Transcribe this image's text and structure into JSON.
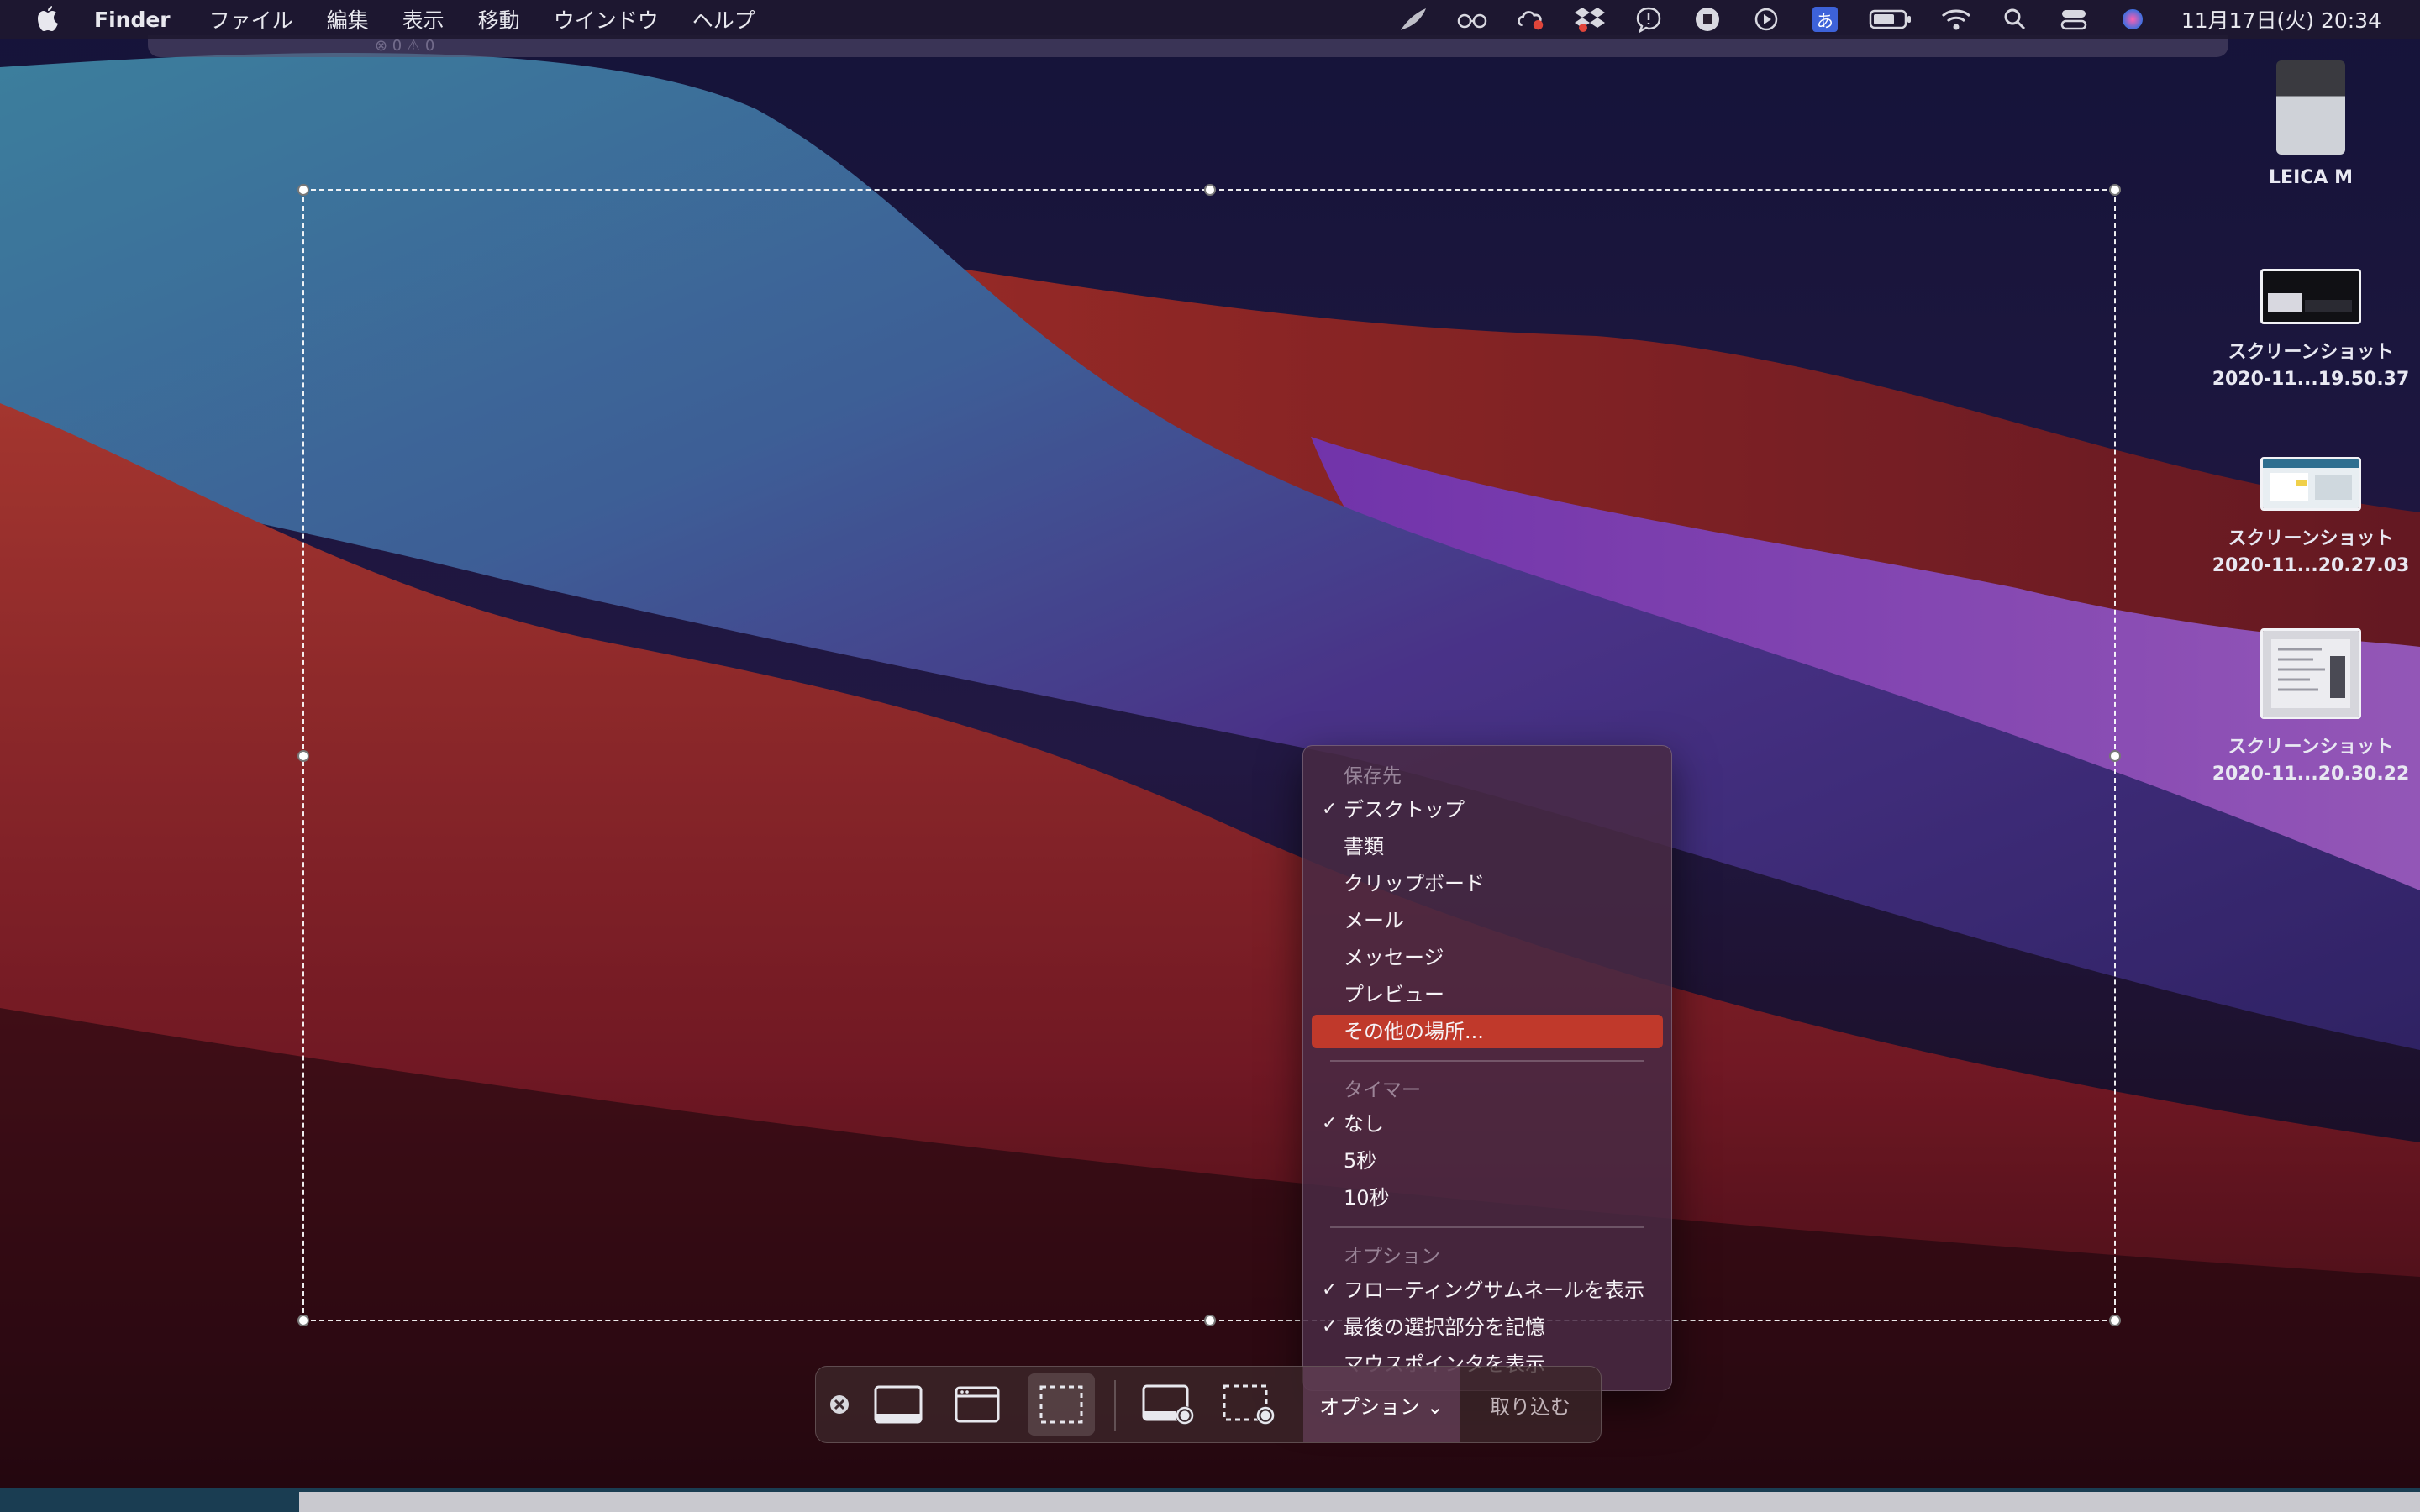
{
  "menubar": {
    "app_name": "Finder",
    "items": [
      "ファイル",
      "編集",
      "表示",
      "移動",
      "ウインドウ",
      "ヘルプ"
    ],
    "ime_char": "あ",
    "clock": "11月17日(火) 20:34"
  },
  "desktop": {
    "items": [
      {
        "label1": "LEICA M",
        "label2": ""
      },
      {
        "label1": "スクリーンショット",
        "label2": "2020-11...19.50.37"
      },
      {
        "label1": "スクリーンショット",
        "label2": "2020-11...20.27.03"
      },
      {
        "label1": "スクリーンショット",
        "label2": "2020-11...20.30.22"
      }
    ]
  },
  "options_menu": {
    "save_header": "保存先",
    "save_items": [
      {
        "label": "デスクトップ",
        "checked": true
      },
      {
        "label": "書類",
        "checked": false
      },
      {
        "label": "クリップボード",
        "checked": false
      },
      {
        "label": "メール",
        "checked": false
      },
      {
        "label": "メッセージ",
        "checked": false
      },
      {
        "label": "プレビュー",
        "checked": false
      },
      {
        "label": "その他の場所...",
        "checked": false,
        "selected": true
      }
    ],
    "timer_header": "タイマー",
    "timer_items": [
      {
        "label": "なし",
        "checked": true
      },
      {
        "label": "5秒",
        "checked": false
      },
      {
        "label": "10秒",
        "checked": false
      }
    ],
    "options_header": "オプション",
    "option_items": [
      {
        "label": "フローティングサムネールを表示",
        "checked": true
      },
      {
        "label": "最後の選択部分を記憶",
        "checked": true
      },
      {
        "label": "マウスポインタを表示",
        "checked": false
      }
    ]
  },
  "toolbar": {
    "options_label": "オプション ⌄",
    "capture_label": "取り込む"
  },
  "colors": {
    "selected_item": "#c0392b",
    "accent_blue": "#3d62d9"
  }
}
